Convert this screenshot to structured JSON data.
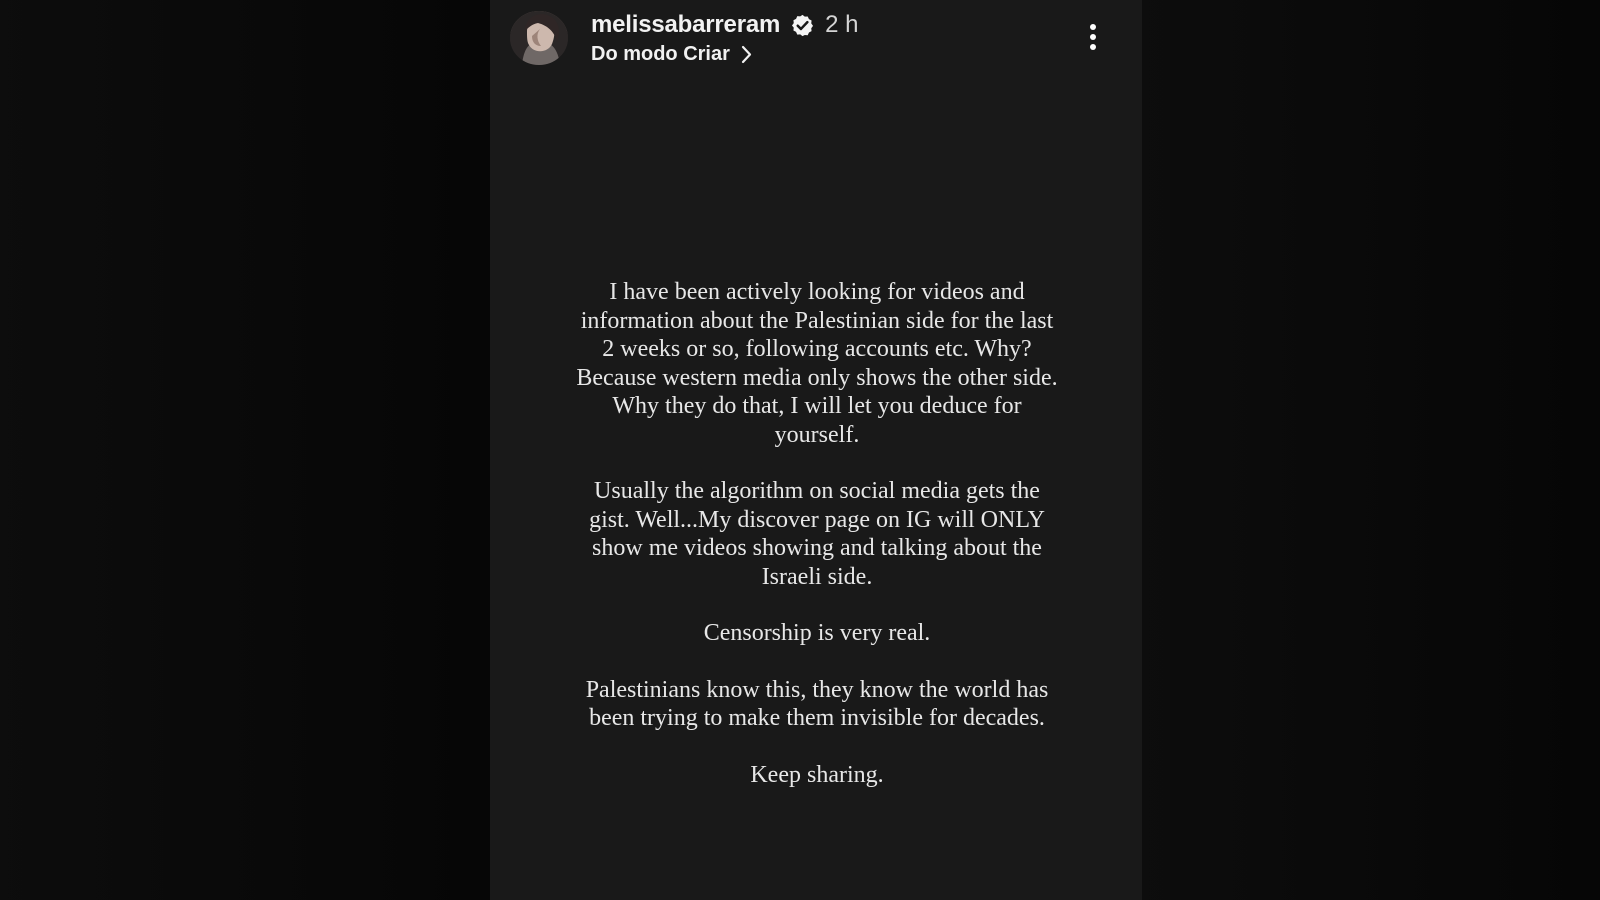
{
  "story": {
    "username": "melissabarreram",
    "timestamp": "2 h",
    "source_label": "Do modo Criar",
    "paragraphs": [
      "I have been actively looking for videos and information about the Palestinian side for the last 2 weeks or so, following accounts etc. Why? Because western media only shows the other side. Why they do that, I will let you deduce for yourself.",
      "Usually the algorithm on social media gets the gist. Well...My discover page on IG will ONLY show me videos showing and talking about the Israeli side.",
      "Censorship is very real.",
      "Palestinians know this, they know the world has been trying to make them invisible for decades.",
      "Keep sharing."
    ]
  },
  "icons": {
    "verified": "verified-badge-icon",
    "source_arrow": "chevron-right-icon",
    "menu": "more-vertical-icon"
  },
  "colors": {
    "background": "#060606",
    "story_background": "#191919",
    "text": "#e7e7e7"
  }
}
